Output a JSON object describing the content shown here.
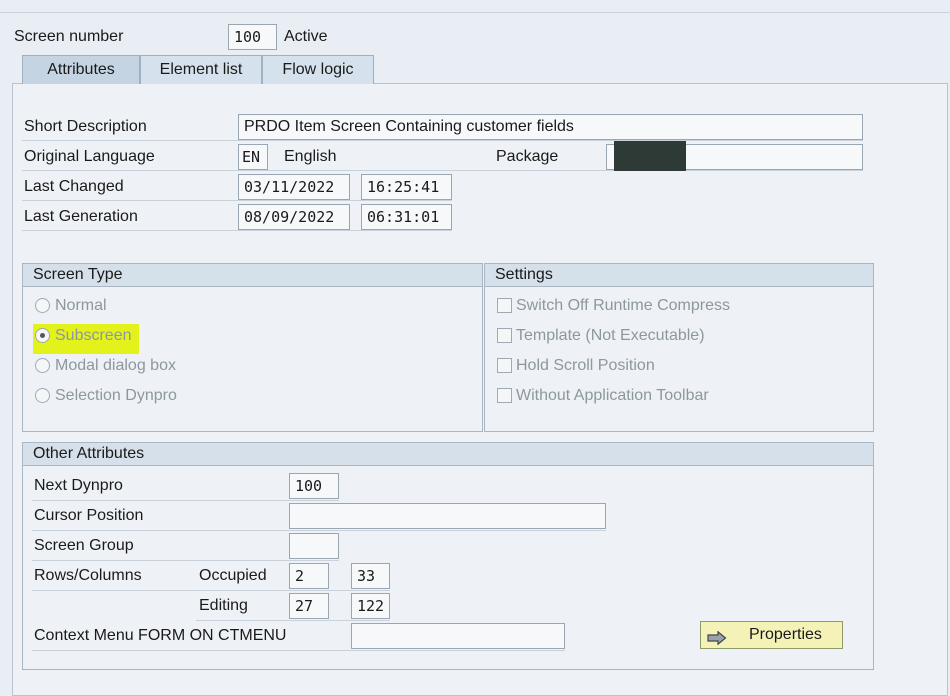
{
  "screen": {
    "label": "Screen number",
    "number": "100",
    "status": "Active"
  },
  "tabs": [
    {
      "label": "Attributes",
      "active": true
    },
    {
      "label": "Element list",
      "active": false
    },
    {
      "label": "Flow logic",
      "active": false
    }
  ],
  "attributes": {
    "short_description": {
      "label": "Short Description",
      "value": "PRDO Item Screen Containing customer fields"
    },
    "original_language": {
      "label": "Original Language",
      "code": "EN",
      "name": "English"
    },
    "package": {
      "label": "Package",
      "value": ""
    },
    "last_changed": {
      "label": "Last Changed",
      "date": "03/11/2022",
      "time": "16:25:41"
    },
    "last_generation": {
      "label": "Last Generation",
      "date": "08/09/2022",
      "time": "06:31:01"
    }
  },
  "screen_type": {
    "title": "Screen Type",
    "options": [
      {
        "label": "Normal",
        "selected": false
      },
      {
        "label": "Subscreen",
        "selected": true
      },
      {
        "label": "Modal dialog box",
        "selected": false
      },
      {
        "label": "Selection Dynpro",
        "selected": false
      }
    ]
  },
  "settings": {
    "title": "Settings",
    "options": [
      {
        "label": "Switch Off Runtime Compress",
        "checked": false
      },
      {
        "label": "Template (Not Executable)",
        "checked": false
      },
      {
        "label": "Hold Scroll Position",
        "checked": false
      },
      {
        "label": "Without Application Toolbar",
        "checked": false
      }
    ]
  },
  "other_attributes": {
    "title": "Other Attributes",
    "next_dynpro": {
      "label": "Next Dynpro",
      "value": "100"
    },
    "cursor_position": {
      "label": "Cursor Position",
      "value": ""
    },
    "screen_group": {
      "label": "Screen Group",
      "value": ""
    },
    "rows_columns": {
      "label": "Rows/Columns",
      "occupied": {
        "label": "Occupied",
        "rows": "2",
        "cols": "33"
      },
      "editing": {
        "label": "Editing",
        "rows": "27",
        "cols": "122"
      }
    },
    "context_menu": {
      "label": "Context Menu FORM ON CTMENU",
      "value": ""
    },
    "properties_button": {
      "label": "Properties"
    }
  },
  "colors": {
    "highlight": "#e4f21c",
    "button": "#f5f2b8",
    "tab_active": "#c4d4e3"
  }
}
